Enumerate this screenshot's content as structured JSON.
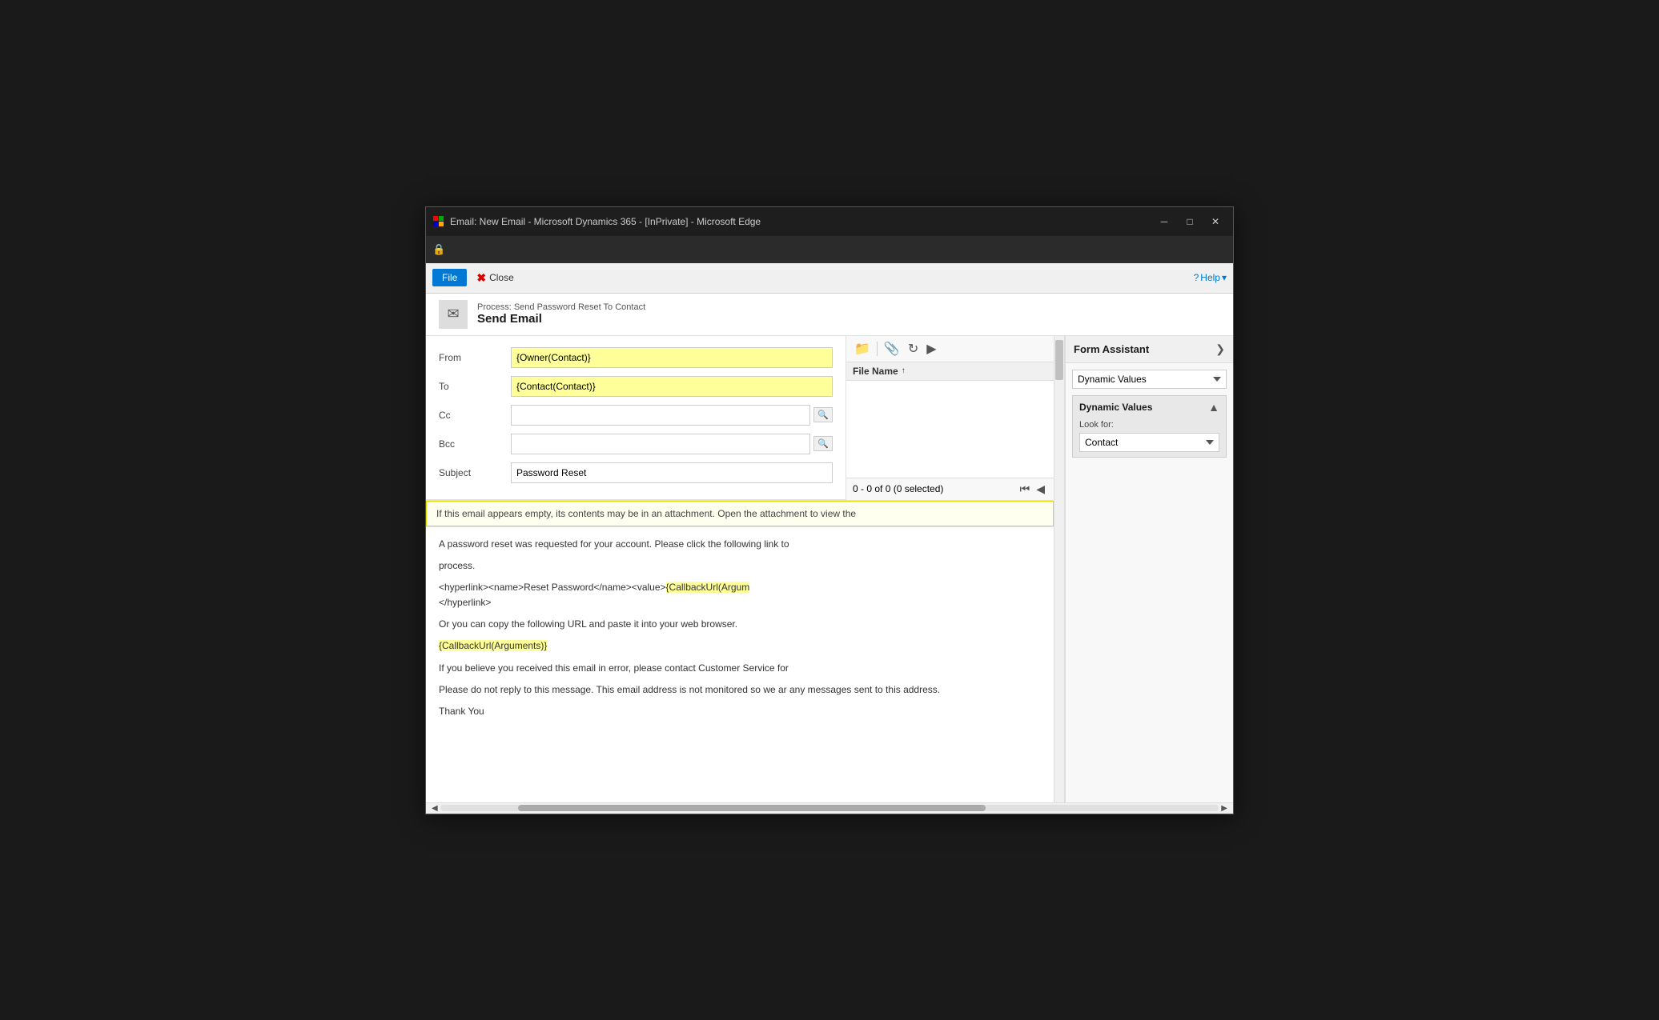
{
  "window": {
    "title": "Email: New Email - Microsoft Dynamics 365 - [InPrivate] - Microsoft Edge",
    "controls": {
      "minimize": "─",
      "maximize": "□",
      "close": "✕"
    }
  },
  "command_bar": {
    "file_label": "File",
    "close_label": "Close",
    "help_label": "Help"
  },
  "page_header": {
    "process_text": "Process: Send Password Reset To Contact",
    "title": "Send Email"
  },
  "form": {
    "from_label": "From",
    "from_value": "{Owner(Contact)}",
    "to_label": "To",
    "to_value": "{Contact(Contact)}",
    "cc_label": "Cc",
    "bcc_label": "Bcc",
    "subject_label": "Subject",
    "subject_value": "Password Reset"
  },
  "attachment": {
    "file_name_label": "File Name",
    "pagination_text": "0 - 0 of 0 (0 selected)"
  },
  "warning": {
    "text": "If this email appears empty, its contents may be in an attachment. Open the attachment to view the"
  },
  "email_body": {
    "para1": "A password reset was requested for your account. Please click the following link to",
    "para1b": "process.",
    "hyperlink_prefix": "<hyperlink><name>Reset Password</name><value>",
    "hyperlink_dynamic": "{CallbackUrl(Argum",
    "hyperlink_suffix": "</hyperlink>",
    "para2": "Or you can copy the following URL and paste it into your web browser.",
    "callback_url": "{CallbackUrl(Arguments)}",
    "para3": "If you believe you received this email in error, please contact Customer Service for",
    "para4": "Please do not reply to this message. This email address is not monitored so we ar any messages sent to this address.",
    "para5": "Thank You"
  },
  "right_panel": {
    "title": "Form Assistant",
    "expand_arrow": "❯",
    "dropdown_value": "Dynamic Values",
    "dynamic_values_title": "Dynamic Values",
    "look_for_label": "Look for:",
    "look_for_value": "Contact",
    "collapse_icon": "▲"
  },
  "icons": {
    "lock": "🔒",
    "email": "✉",
    "file_manager": "📁",
    "attach": "📎",
    "refresh": "↻",
    "play": "▶",
    "question": "?",
    "scroll_left": "◀",
    "scroll_right": "▶"
  }
}
